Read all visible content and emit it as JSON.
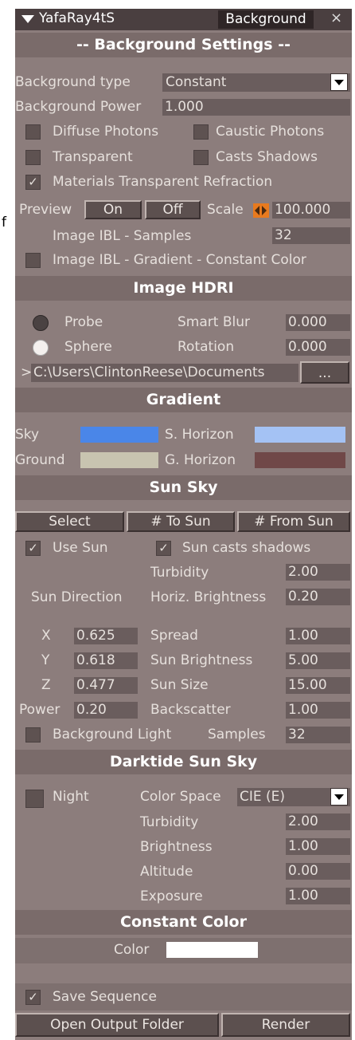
{
  "stray_char": "f",
  "title": {
    "plugin": "YafaRay4tS",
    "tab": "Background",
    "close": "×"
  },
  "headers": {
    "bg_settings": "-- Background Settings --",
    "hdri": "Image HDRI",
    "gradient": "Gradient",
    "sunsky": "Sun Sky",
    "darktide": "Darktide Sun Sky",
    "constant": "Constant Color"
  },
  "bg": {
    "type_label": "Background type",
    "type_value": "Constant",
    "power_label": "Background Power",
    "power_value": "1.000",
    "diffuse": "Diffuse Photons",
    "caustic": "Caustic Photons",
    "transparent": "Transparent",
    "casts": "Casts Shadows",
    "mat_refr": "Materials Transparent Refraction",
    "mat_refr_check": "✓",
    "preview": "Preview",
    "on": "On",
    "off": "Off",
    "scale_label": "Scale",
    "scale_value": "100.000",
    "ibl_samples_label": "Image IBL - Samples",
    "ibl_samples_value": "32",
    "ibl_gradient": "Image IBL - Gradient - Constant  Color"
  },
  "hdri": {
    "probe": "Probe",
    "sphere": "Sphere",
    "smart_blur_label": "Smart Blur",
    "smart_blur_value": "0.000",
    "rotation_label": "Rotation",
    "rotation_value": "0.000",
    "path_prefix": ">",
    "path": "C:\\Users\\ClintonReese\\Documents",
    "browse": "..."
  },
  "gradient": {
    "sky": "Sky",
    "s_horizon": "S. Horizon",
    "ground": "Ground",
    "g_horizon": "G. Horizon",
    "colors": {
      "sky": "#4a86e8",
      "s_horizon": "#a4c2f4",
      "ground": "#c8c4b0",
      "g_horizon": "#704848"
    }
  },
  "sunsky": {
    "select": "Select",
    "to_sun": "# To Sun",
    "from_sun": "# From Sun",
    "use_sun": "Use Sun",
    "use_sun_check": "✓",
    "casts": "Sun casts shadows",
    "casts_check": "✓",
    "turbidity_label": "Turbidity",
    "turbidity_value": "2.00",
    "direction": "Sun Direction",
    "horiz_label": "Horiz. Brightness",
    "horiz_value": "0.20",
    "x_label": "X",
    "x_value": "0.625",
    "y_label": "Y",
    "y_value": "0.618",
    "z_label": "Z",
    "z_value": "0.477",
    "spread_label": "Spread",
    "spread_value": "1.00",
    "sun_bright_label": "Sun Brightness",
    "sun_bright_value": "5.00",
    "sun_size_label": "Sun Size",
    "sun_size_value": "15.00",
    "power_label": "Power",
    "power_value": "0.20",
    "backscatter_label": "Backscatter",
    "backscatter_value": "1.00",
    "bg_light": "Background Light",
    "samples_label": "Samples",
    "samples_value": "32"
  },
  "darktide": {
    "night": "Night",
    "color_space_label": "Color Space",
    "color_space_value": "CIE (E)",
    "turbidity_label": "Turbidity",
    "turbidity_value": "2.00",
    "brightness_label": "Brightness",
    "brightness_value": "1.00",
    "altitude_label": "Altitude",
    "altitude_value": "0.00",
    "exposure_label": "Exposure",
    "exposure_value": "1.00"
  },
  "constant": {
    "color_label": "Color",
    "color": "#ffffff"
  },
  "footer": {
    "save_seq": "Save Sequence",
    "save_seq_check": "✓",
    "open_folder": "Open Output Folder",
    "render": "Render"
  }
}
